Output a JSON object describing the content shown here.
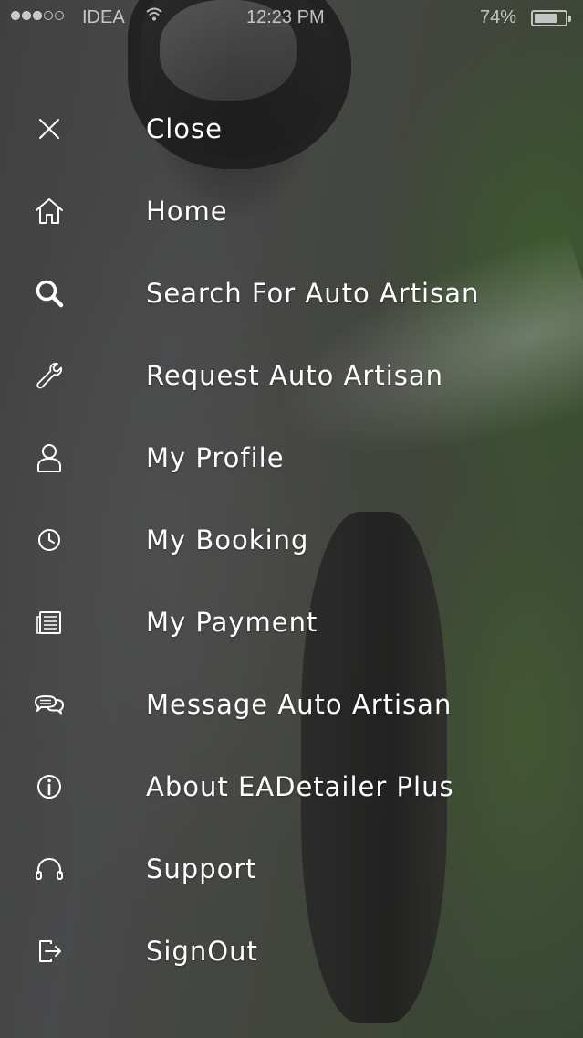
{
  "status_bar": {
    "carrier": "IDEA",
    "time": "12:23 PM",
    "battery_percent": "74%",
    "battery_level": 0.74,
    "signal_bars_filled": 3,
    "signal_bars_total": 5
  },
  "menu": {
    "items": [
      {
        "label": "Close",
        "icon": "close-icon"
      },
      {
        "label": "Home",
        "icon": "home-icon"
      },
      {
        "label": "Search For Auto Artisan",
        "icon": "search-icon"
      },
      {
        "label": "Request Auto Artisan",
        "icon": "wrench-icon"
      },
      {
        "label": "My Profile",
        "icon": "user-icon"
      },
      {
        "label": "My Booking",
        "icon": "clock-icon"
      },
      {
        "label": "My Payment",
        "icon": "document-icon"
      },
      {
        "label": "Message Auto Artisan",
        "icon": "chat-bubbles-icon"
      },
      {
        "label": "About EADetailer Plus",
        "icon": "info-icon"
      },
      {
        "label": "Support",
        "icon": "headphones-icon"
      },
      {
        "label": "SignOut",
        "icon": "signout-icon"
      }
    ]
  },
  "colors": {
    "text": "#ffffff",
    "background": "#3b3d3a"
  }
}
